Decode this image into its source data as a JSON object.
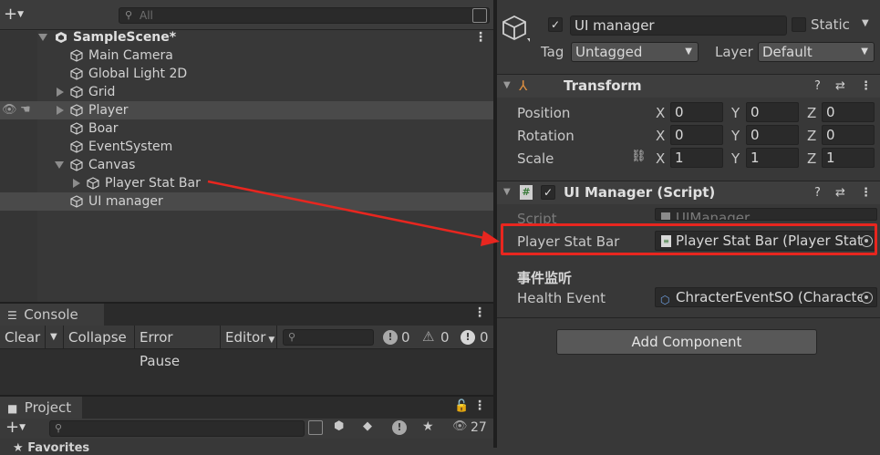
{
  "hierarchy": {
    "search_placeholder": "All",
    "scene_name": "SampleScene*",
    "items": [
      {
        "label": "Main Camera"
      },
      {
        "label": "Global Light 2D"
      },
      {
        "label": "Grid"
      },
      {
        "label": "Player"
      },
      {
        "label": "Boar"
      },
      {
        "label": "EventSystem"
      },
      {
        "label": "Canvas"
      },
      {
        "label": "Player Stat Bar"
      },
      {
        "label": "UI manager"
      }
    ]
  },
  "console": {
    "tab_label": "Console",
    "buttons": {
      "clear": "Clear",
      "collapse": "Collapse",
      "error_pause": "Error Pause",
      "editor": "Editor"
    },
    "counts": {
      "logs": "0",
      "warnings": "0",
      "errors": "0"
    }
  },
  "project": {
    "tab_label": "Project",
    "hidden_count": "27",
    "favorites": "Favorites"
  },
  "inspector": {
    "object_name": "UI manager",
    "static_label": "Static",
    "tag_label": "Tag",
    "tag_value": "Untagged",
    "layer_label": "Layer",
    "layer_value": "Default",
    "transform": {
      "title": "Transform",
      "rows": [
        {
          "label": "Position",
          "x": "0",
          "y": "0",
          "z": "0"
        },
        {
          "label": "Rotation",
          "x": "0",
          "y": "0",
          "z": "0"
        },
        {
          "label": "Scale",
          "x": "1",
          "y": "1",
          "z": "1"
        }
      ]
    },
    "ui_manager": {
      "title": "UI Manager (Script)",
      "script_label": "Script",
      "script_value": "UIManager",
      "player_stat_bar_label": "Player Stat Bar",
      "player_stat_bar_value": "Player Stat Bar (Player Stat",
      "event_header": "事件监听",
      "health_event_label": "Health Event",
      "health_event_value": "ChracterEventSO (Characte"
    },
    "add_component": "Add Component"
  },
  "colors": {
    "highlight": "#e8261f",
    "selected_row": "#4a4a4a"
  }
}
